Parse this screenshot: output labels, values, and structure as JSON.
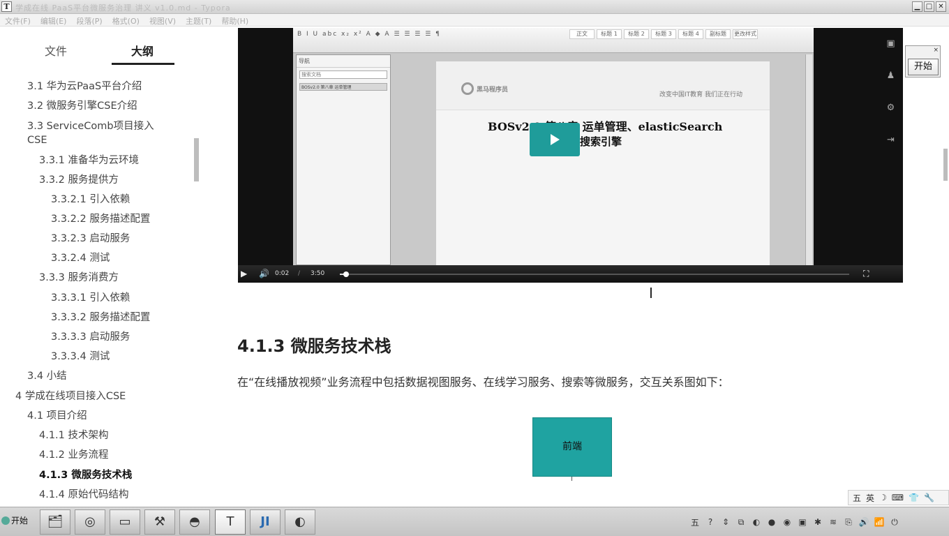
{
  "window": {
    "app_icon": "T",
    "title": "学成在线 PaaS平台微服务治理 讲义 v1.0.md - Typora"
  },
  "menu": [
    "文件(F)",
    "编辑(E)",
    "段落(P)",
    "格式(O)",
    "视图(V)",
    "主题(T)",
    "帮助(H)"
  ],
  "sidebar": {
    "tabs": [
      "文件",
      "大纲"
    ],
    "active_tab": "大纲",
    "outline": [
      "3.1 华为云PaaS平台介绍",
      "3.2 微服务引擎CSE介绍",
      "3.3 ServiceComb项目接入",
      "CSE",
      "3.3.1 准备华为云环境",
      "3.3.2 服务提供方",
      "3.3.2.1 引入依赖",
      "3.3.2.2 服务描述配置",
      "3.3.2.3 启动服务",
      "3.3.2.4 测试",
      "3.3.3 服务消费方",
      "3.3.3.1 引入依赖",
      "3.3.3.2 服务描述配置",
      "3.3.3.3 启动服务",
      "3.3.3.4 测试",
      "3.4 小结",
      "4 学成在线项目接入CSE",
      "4.1 项目介绍",
      "4.1.1 技术架构",
      "4.1.2 业务流程",
      "4.1.3 微服务技术栈",
      "4.1.4 原始代码结构"
    ],
    "footer": {
      "collapse": "‹",
      "source": "</>"
    }
  },
  "video": {
    "doc_title": "BOSv2.0  第八章  运单管理、elasticSearch",
    "doc_subtitle": "搜索引擎",
    "logo_text": "黑马程序员",
    "slogan": "改变中国IT教育  我们正在行动",
    "nav_title": "导航",
    "nav_search": "搜索文档",
    "nav_item": "BOSv2.0 第八章 运单管理",
    "ribbon_styles": [
      "正文",
      "标题 1",
      "标题 2",
      "标题 3",
      "标题 4",
      "副标题",
      "更改样式"
    ],
    "current_time": "0:02",
    "duration": "3:50",
    "progress": 0.009
  },
  "content": {
    "heading": "4.1.3 微服务技术栈",
    "paragraph": "在“在线播放视频”业务流程中包括数据视图服务、在线学习服务、搜索等微服务，交互关系图如下：",
    "diagram_box": "前端"
  },
  "popup": {
    "button": "开始",
    "close": "×"
  },
  "ime": [
    "五",
    "英",
    "☽",
    "⌨",
    "👕",
    "🔧"
  ],
  "taskbar": {
    "start_label": "开始",
    "apps": [
      "explorer",
      "browser",
      "terminal",
      "tool",
      "turtle",
      "T",
      "JI",
      "player"
    ],
    "active_app": "T"
  },
  "tray": [
    "五",
    "?",
    "⇕",
    "⧉",
    "◐",
    "●",
    "◉",
    "▣",
    "✱",
    "≋",
    "⎘",
    "🔊",
    "📶",
    "⏻"
  ]
}
